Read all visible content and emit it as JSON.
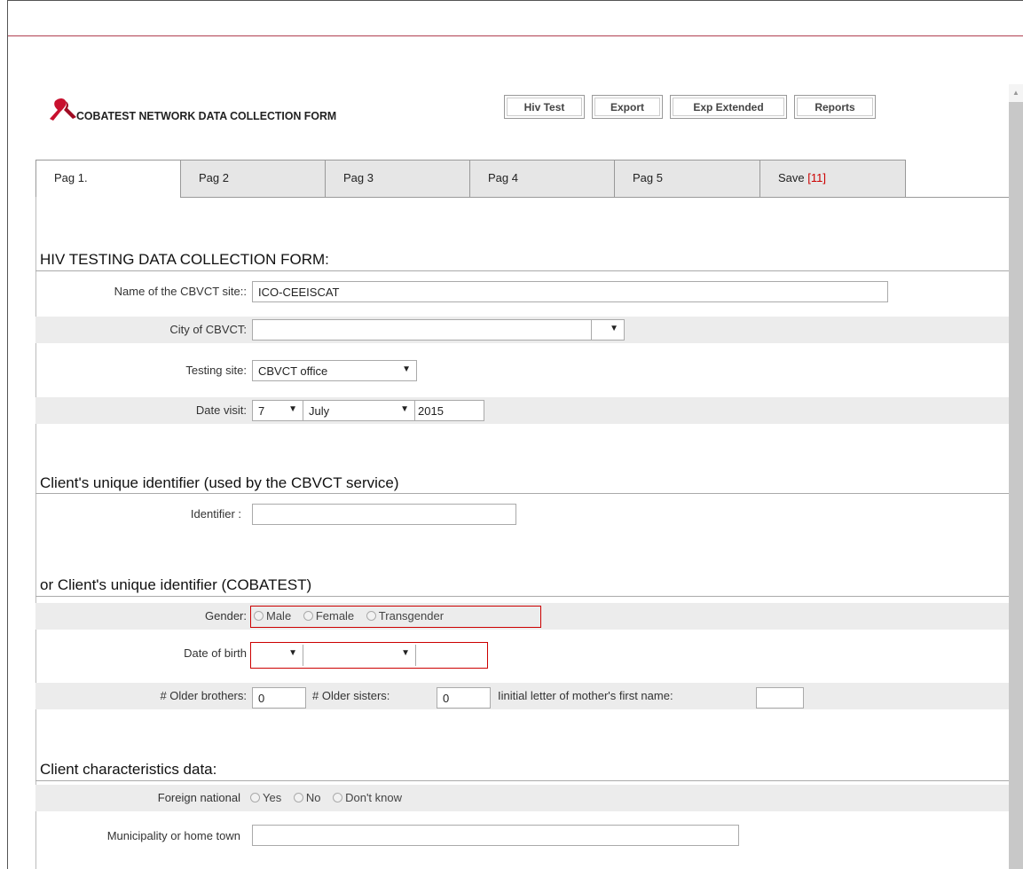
{
  "header": {
    "title": "COBATEST NETWORK DATA COLLECTION FORM",
    "buttons": [
      "Hiv Test",
      "Export",
      "Exp Extended",
      "Reports"
    ]
  },
  "tabs": [
    {
      "label": "Pag 1."
    },
    {
      "label": "Pag 2"
    },
    {
      "label": "Pag 3"
    },
    {
      "label": "Pag 4"
    },
    {
      "label": "Pag 5"
    },
    {
      "label": "Save ",
      "count": "[11]"
    }
  ],
  "section1": {
    "title": "HIV TESTING DATA COLLECTION FORM:",
    "site_label": "Name of the CBVCT site::",
    "site_value": "ICO-CEEISCAT",
    "city_label": "City of CBVCT:",
    "city_value": "",
    "testing_label": "Testing site:",
    "testing_value": "CBVCT office",
    "date_label": "Date visit:",
    "date_day": "7",
    "date_month": "July",
    "date_year": "2015"
  },
  "section2": {
    "title": "Client's unique identifier (used by the CBVCT service)",
    "identifier_label": "Identifier :",
    "identifier_value": ""
  },
  "section3": {
    "title": "or Client's unique identifier (COBATEST)",
    "gender_label": "Gender:",
    "gender_options": [
      "Male",
      "Female",
      "Transgender"
    ],
    "dob_label": "Date of birth",
    "brothers_label": "# Older brothers:",
    "brothers_value": "0",
    "sisters_label": "# Older sisters:",
    "sisters_value": "0",
    "mother_label": "Iinitial letter of mother's first name:",
    "mother_value": ""
  },
  "section4": {
    "title": "Client characteristics data:",
    "foreign_label": "Foreign national",
    "foreign_options": [
      "Yes",
      "No",
      "Don't know"
    ],
    "municipality_label": "Municipality or home town",
    "municipality_value": ""
  }
}
